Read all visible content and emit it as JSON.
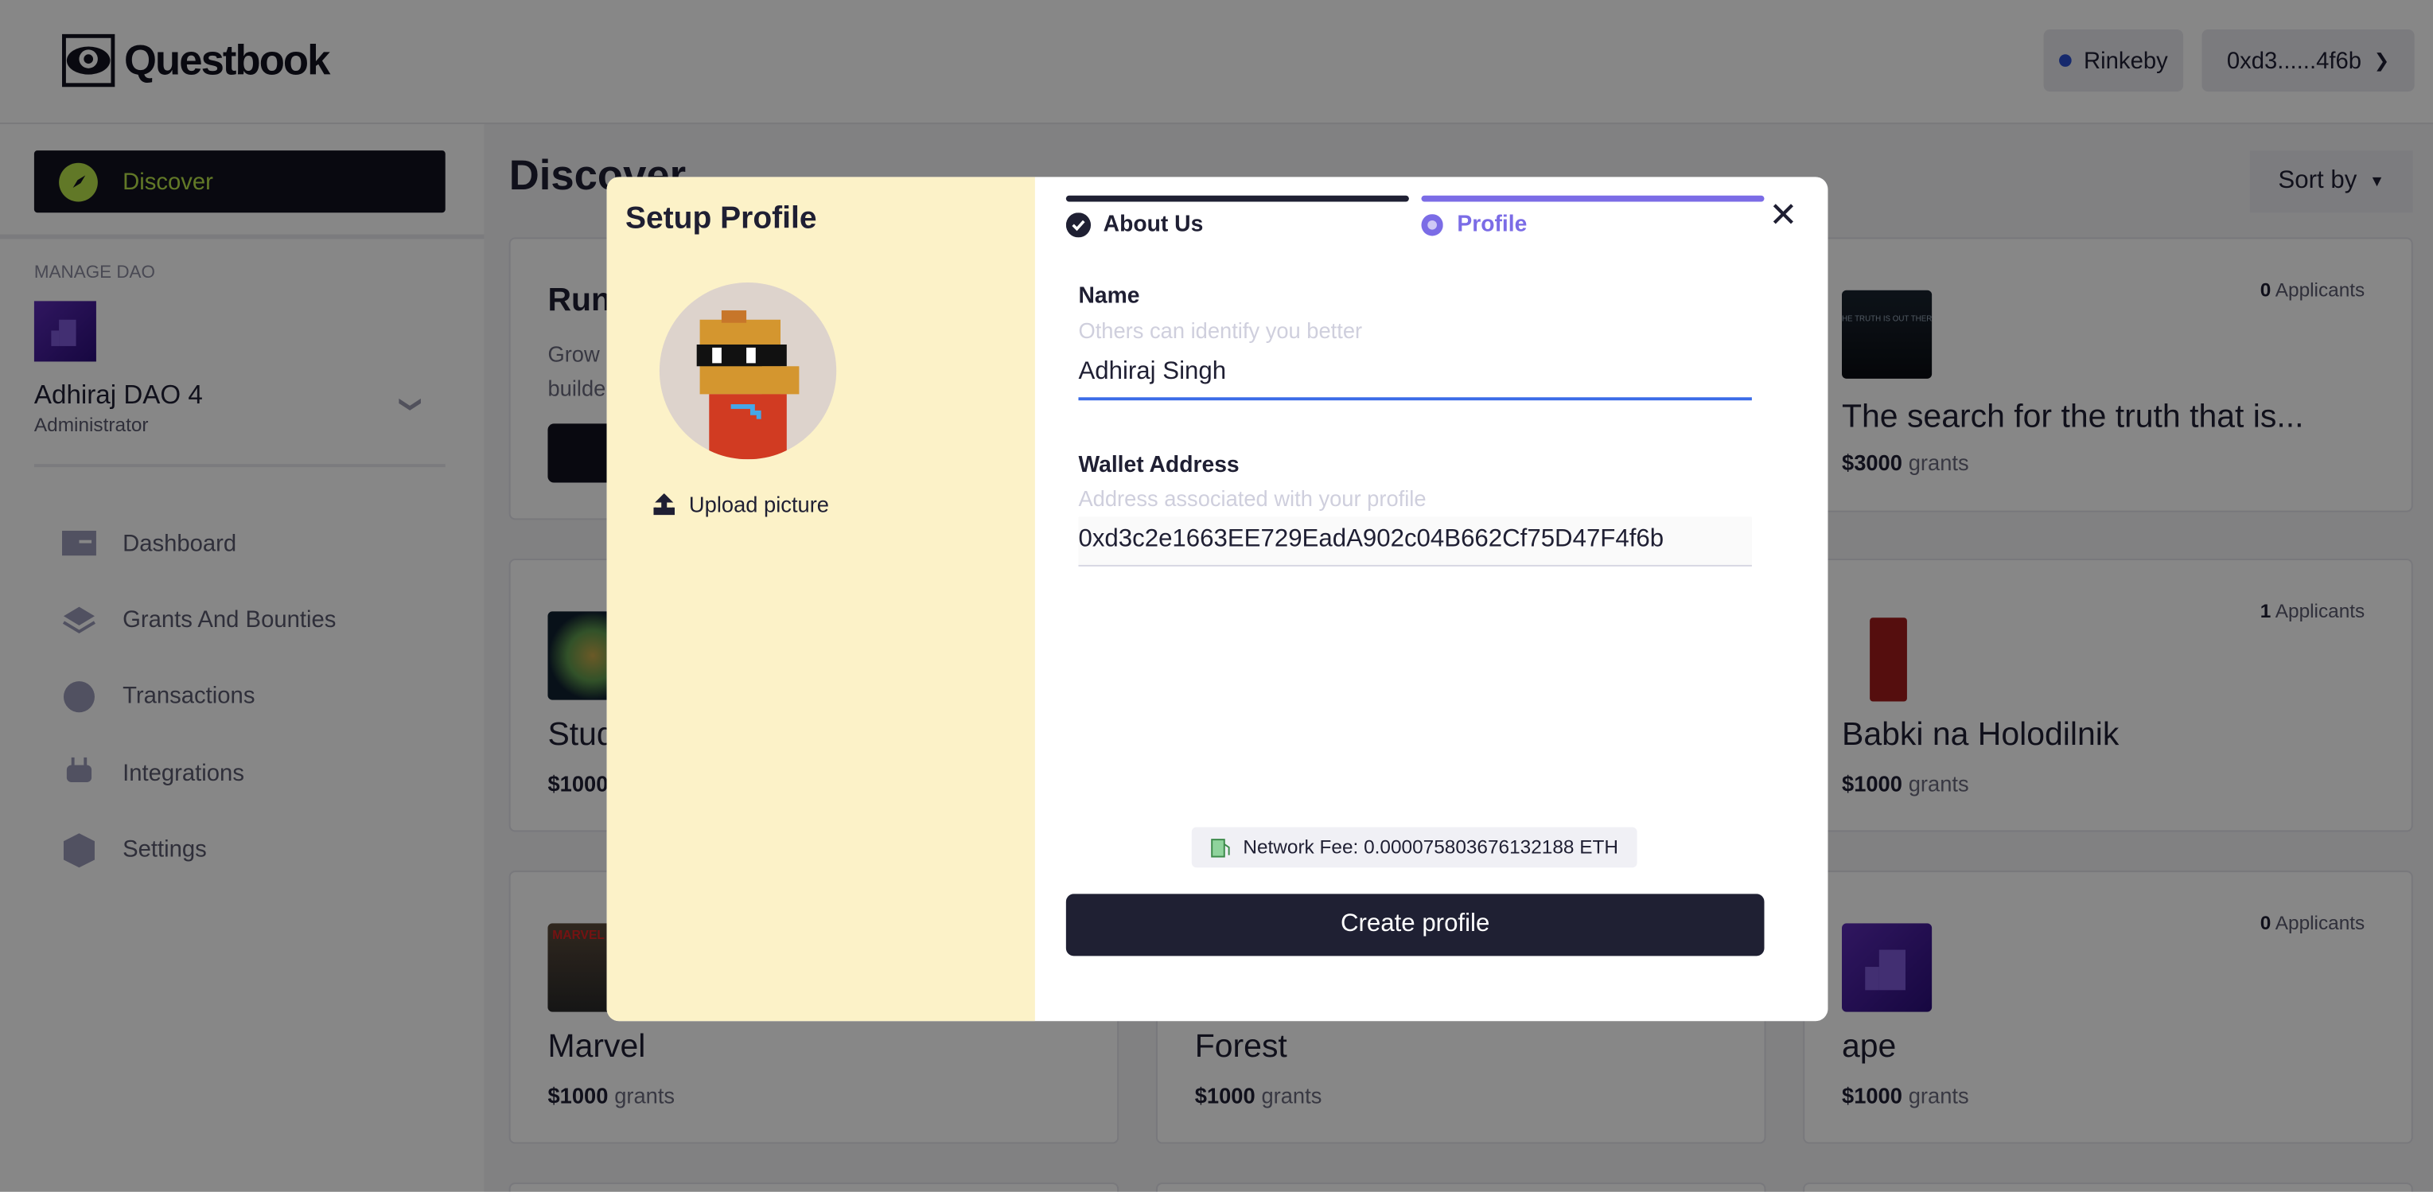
{
  "header": {
    "logo_text": "Questbook",
    "network": {
      "label": "Rinkeby",
      "dot_color": "#2a4fcf"
    },
    "wallet": {
      "label": "0xd3......4f6b"
    }
  },
  "sidebar": {
    "discover_label": "Discover",
    "manage_dao_label": "MANAGE DAO",
    "dao": {
      "name": "Adhiraj DAO 4",
      "role": "Administrator"
    },
    "items": [
      {
        "label": "Dashboard",
        "icon": "dashboard-icon"
      },
      {
        "label": "Grants And Bounties",
        "icon": "layers-icon"
      },
      {
        "label": "Transactions",
        "icon": "coin-icon"
      },
      {
        "label": "Integrations",
        "icon": "plug-icon"
      },
      {
        "label": "Settings",
        "icon": "hexagon-gear-icon"
      }
    ]
  },
  "main": {
    "title": "Discover",
    "sort_label": "Sort by",
    "cards": [
      {
        "title": "Run",
        "desc1": "Grow",
        "desc2": "builde"
      },
      {
        "title": "The search for the truth that is...",
        "amount": "$3000",
        "unit": "grants",
        "applicants": "0",
        "applicants_label": "Applicants",
        "thumb_text": "HE TRUTH IS OUT THER"
      },
      {
        "title": "Stud",
        "amount": "$1000"
      },
      {
        "title": "Babki na Holodilnik",
        "amount": "$1000",
        "unit": "grants",
        "applicants": "1",
        "applicants_label": "Applicants"
      },
      {
        "title": "Marvel",
        "amount": "$1000",
        "unit": "grants",
        "thumb_text": "MARVEL"
      },
      {
        "title": "Forest",
        "amount": "$1000",
        "unit": "grants"
      },
      {
        "title": "ape",
        "amount": "$1000",
        "unit": "grants",
        "applicants": "0",
        "applicants_label": "Applicants"
      }
    ]
  },
  "modal": {
    "title": "Setup Profile",
    "upload_label": "Upload picture",
    "steps": [
      {
        "label": "About Us",
        "state": "done"
      },
      {
        "label": "Profile",
        "state": "active"
      }
    ],
    "name": {
      "label": "Name",
      "helper": "Others can identify you better",
      "value": "Adhiraj Singh"
    },
    "wallet": {
      "label": "Wallet Address",
      "helper": "Address associated with your profile",
      "value": "0xd3c2e1663EE729EadA902c04B662Cf75D47F4f6b"
    },
    "network_fee": "Network Fee: 0.000075803676132188 ETH",
    "submit_label": "Create profile"
  },
  "colors": {
    "accent": "#7b6ce6",
    "input_focus": "#3b6ce8",
    "dark": "#1f2033",
    "panel": "#fcf2c8",
    "discover_green": "#b8e34a"
  }
}
